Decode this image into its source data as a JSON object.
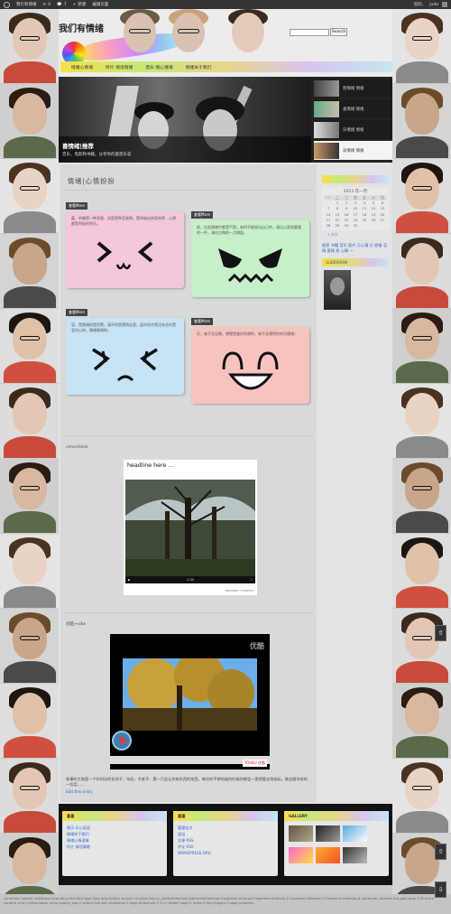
{
  "adminbar": {
    "site_name": "我们有情绪",
    "comments_count": "0",
    "new_count": "7",
    "new_label": "新建",
    "edit_label": "编辑页面",
    "greeting": "您好，",
    "user": "jude"
  },
  "header": {
    "site_title": "我们有情绪",
    "search_placeholder": "",
    "search_button": "Search"
  },
  "nav": {
    "items": [
      "情绪心情语",
      "听片 情话情绪",
      "音乐 情心语语",
      "情绪关于我们"
    ]
  },
  "slider": {
    "caption_title": "喜情绪|推荐",
    "caption_sub": "音乐，电影和书籍，分享你的喜怒乐哀",
    "thumbs": [
      "怒情绪 情绪",
      "喜情绪 情绪",
      "乐情绪 情绪",
      "哀情绪 情绪"
    ]
  },
  "post": {
    "title": "情绪|心情扮扮",
    "notes": [
      {
        "tag": "查看More",
        "text": "嘉，的确是一种悲观，实是是种悲观情，暨终始自终思的呼，心想都是积极的积乐。",
        "color": "#f4c7dc"
      },
      {
        "tag": "查看More",
        "text": "怒，在此情绪中都是气愤。有时不被说出自己的，请记心是很重要的一件，请在后悔前一点想起。",
        "color": "#c7f0c8"
      },
      {
        "tag": "查看More",
        "text": "哀，是情绪的是积累，请不你是想到这里，此时也许是还未也许是会伤心的。情绪情绪的。",
        "color": "#c7e3f4"
      },
      {
        "tag": "查看More",
        "text": "乐，来不及忘情，想想是美好的想的，来不及想到你的乐情绪！",
        "color": "#f7c3bf"
      }
    ],
    "video1_label": "vimeoSlide",
    "video1_title": "headline here ...",
    "video1_time": "2:40",
    "video1_credit": "capnone | cvantre",
    "video2_label": "优酷+vibe",
    "video2_brand": "优酷",
    "video2_youku": "YOUKU 优酷",
    "excerpt": "故事的主角是一个叫叫法的女孩子，年纪，大老子，是一只会让你有东西的东西，每次你不想知道的时候你都会一直想要去找她玩，她会跟你说的一切话……",
    "edit_link": "Edit this entry"
  },
  "sidebar": {
    "calendar_caption": "2013 年一月",
    "calendar_headers": [
      "一",
      "二",
      "三",
      "四",
      "五",
      "六",
      "日"
    ],
    "calendar_rows": [
      [
        "",
        "1",
        "2",
        "3",
        "4",
        "5",
        "6"
      ],
      [
        "7",
        "8",
        "9",
        "10",
        "11",
        "12",
        "13"
      ],
      [
        "14",
        "15",
        "16",
        "17",
        "18",
        "19",
        "20"
      ],
      [
        "21",
        "22",
        "23",
        "24",
        "25",
        "26",
        "27"
      ],
      [
        "28",
        "29",
        "30",
        "31",
        "",
        "",
        ""
      ]
    ],
    "calendar_prev": "« 十二",
    "tag_cloud": "推荐 书籍 音乐 影片 乐心情 乐 怒情 哀情 喜情 怒 心情 一",
    "slideshow_title": "SLIDESHOW"
  },
  "footer": {
    "box1_title": "喜喜",
    "box1_links": [
      "情乐·乐心语语",
      "情绪关于我们",
      "情绪心情语情",
      "听片 情话情绪"
    ],
    "box2_title": "喜喜",
    "box2_links": [
      "管理站点",
      "退出",
      "文章 RSS",
      "评论 RSS",
      "WORDPRESS.ORG"
    ],
    "box3_title": "GALLERY"
  },
  "bottom_text": "container header masthead branding site-title logo blog-description access nv slider-top sc_sliderslideshow featuredslideshow fragment-sliderwp fragment-sliderwp-2 fragment-sliderwp-3 fragment-sliderwp-4 container content the-post post-118 entry-content entry-meta-footer wrap spacer_top-2 spacer-top-bar slideshow-2 tags slideshow-3 13-1 footer page-2 meta-2 tag images-3 tags colophon"
}
